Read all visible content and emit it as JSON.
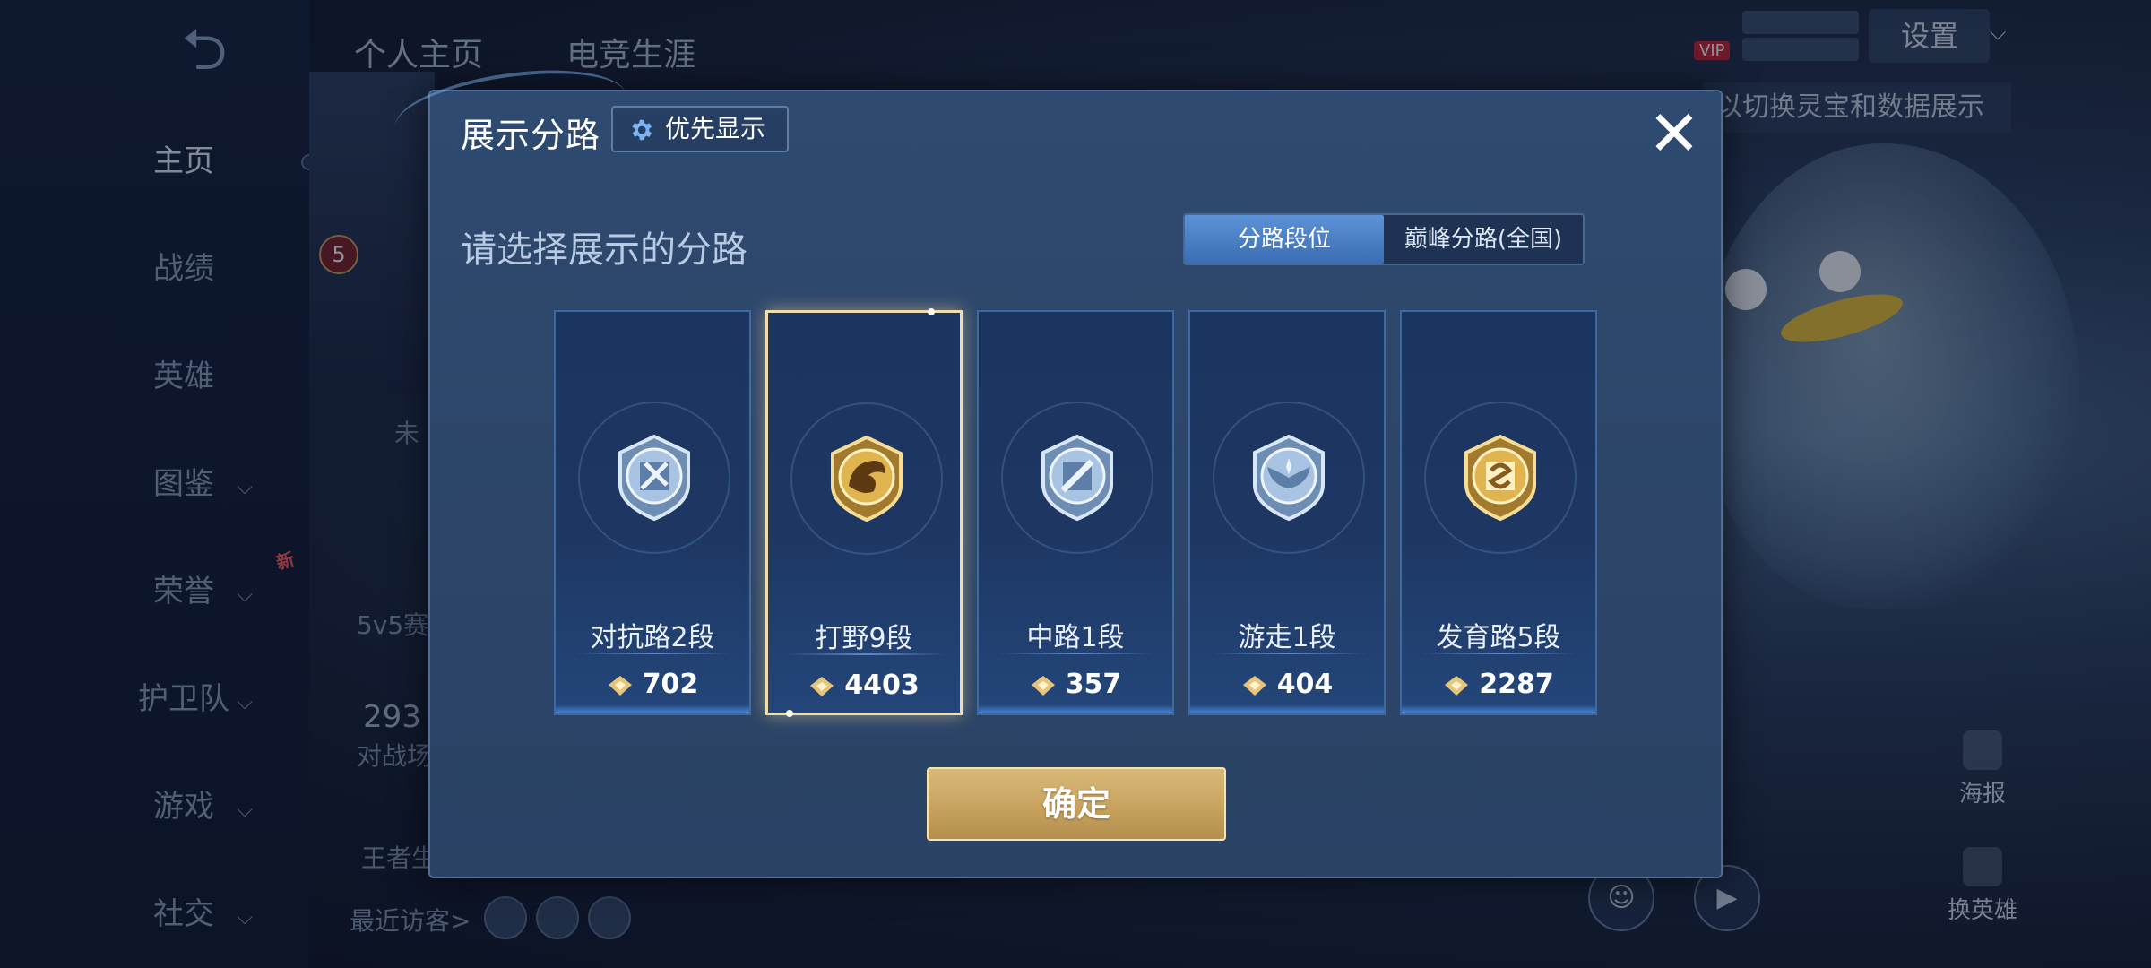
{
  "background": {
    "back_icon": "back-arrow-icon",
    "top_tabs": [
      "个人主页",
      "电竞生涯"
    ],
    "nav": [
      {
        "label": "主页",
        "has_chevron": false,
        "active": true
      },
      {
        "label": "战绩",
        "has_chevron": false
      },
      {
        "label": "英雄",
        "has_chevron": false
      },
      {
        "label": "图鉴",
        "has_chevron": true
      },
      {
        "label": "荣誉",
        "has_chevron": true
      },
      {
        "label": "护卫队",
        "has_chevron": true
      },
      {
        "label": "游戏",
        "has_chevron": true
      },
      {
        "label": "社交",
        "has_chevron": true
      }
    ],
    "new_badge": "新",
    "level": "5",
    "status_text": "未",
    "rank_text": "5v5赛",
    "battle_count": "293",
    "battle_label": "对战场",
    "career_label": "王者生",
    "recent_visitors": "最近访客>",
    "settings": "设置",
    "vip": "VIP",
    "hint_text": "以切换灵宝和数据展示",
    "poster": "海报",
    "change_hero": "换英雄"
  },
  "modal": {
    "title": "展示分路",
    "priority_button": "优先显示",
    "close_icon": "close-icon",
    "subtitle": "请选择展示的分路",
    "segments": [
      "分路段位",
      "巅峰分路(全国)"
    ],
    "active_segment": 0,
    "selected_card": 1,
    "cards": [
      {
        "label": "对抗路2段",
        "score": "702",
        "emblem": "clash-lane-emblem-icon",
        "tier": "silver"
      },
      {
        "label": "打野9段",
        "score": "4403",
        "emblem": "jungle-dragon-emblem-icon",
        "tier": "gold"
      },
      {
        "label": "中路1段",
        "score": "357",
        "emblem": "mid-lane-emblem-icon",
        "tier": "silver"
      },
      {
        "label": "游走1段",
        "score": "404",
        "emblem": "roam-wings-emblem-icon",
        "tier": "silver"
      },
      {
        "label": "发育路5段",
        "score": "2287",
        "emblem": "farm-lane-emblem-icon",
        "tier": "gold"
      }
    ],
    "confirm": "确定"
  },
  "colors": {
    "modal_bg": "#2c4569",
    "selected_border": "#f0dcaa",
    "gold_button": "#c7a35f",
    "segment_active": "#4a80c4"
  }
}
